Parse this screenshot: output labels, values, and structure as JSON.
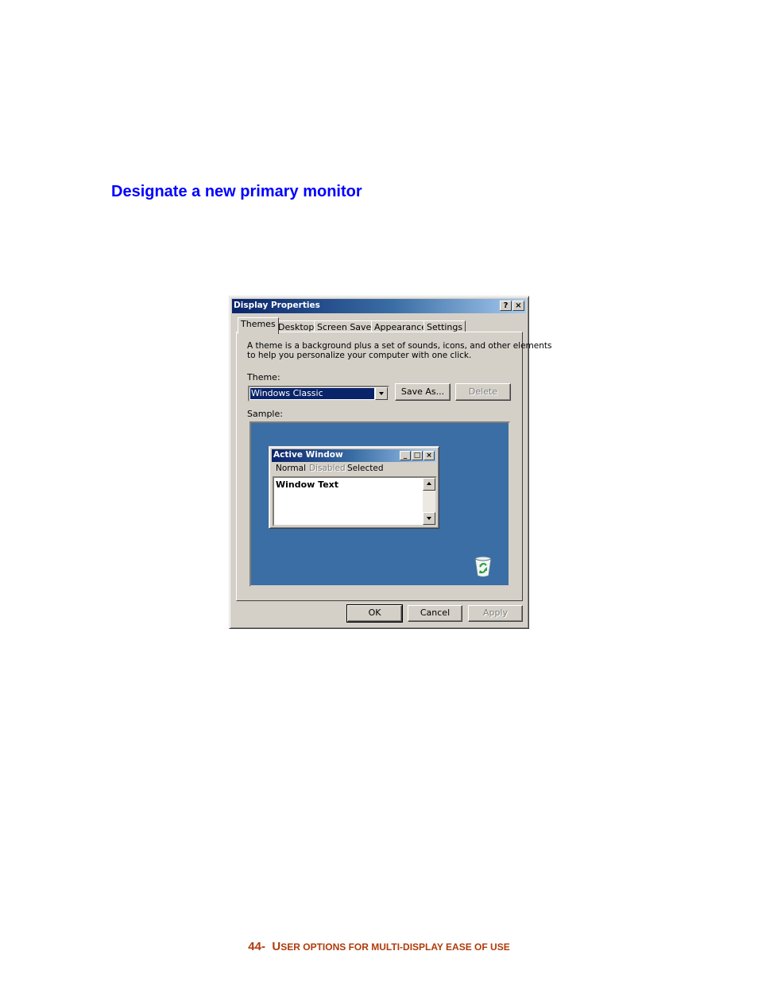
{
  "page": {
    "heading": "Designate a new primary monitor",
    "footer_number": "44-",
    "footer_first_letter": "U",
    "footer_rest": "ser options for multi-display ease of use"
  },
  "dialog": {
    "title": "Display Properties",
    "help_glyph": "?",
    "close_glyph": "×",
    "tabs": [
      {
        "label": "Themes",
        "active": true
      },
      {
        "label": "Desktop",
        "active": false
      },
      {
        "label": "Screen Saver",
        "active": false
      },
      {
        "label": "Appearance",
        "active": false
      },
      {
        "label": "Settings",
        "active": false
      }
    ],
    "description_line1": "A theme is a background plus a set of sounds, icons, and other elements",
    "description_line2": "to help you personalize your computer with one click.",
    "theme_label": "Theme:",
    "theme_value": "Windows Classic",
    "save_as_label": "Save As...",
    "delete_label": "Delete",
    "sample_label": "Sample:",
    "sample": {
      "background_color": "#3a6ea5",
      "window_title": "Active Window",
      "menu_normal": "Normal",
      "menu_disabled": "Disabled",
      "menu_selected": "Selected",
      "window_text": "Window Text",
      "recycle_icon": "recycle-bin-icon"
    },
    "ok_label": "OK",
    "cancel_label": "Cancel",
    "apply_label": "Apply"
  }
}
